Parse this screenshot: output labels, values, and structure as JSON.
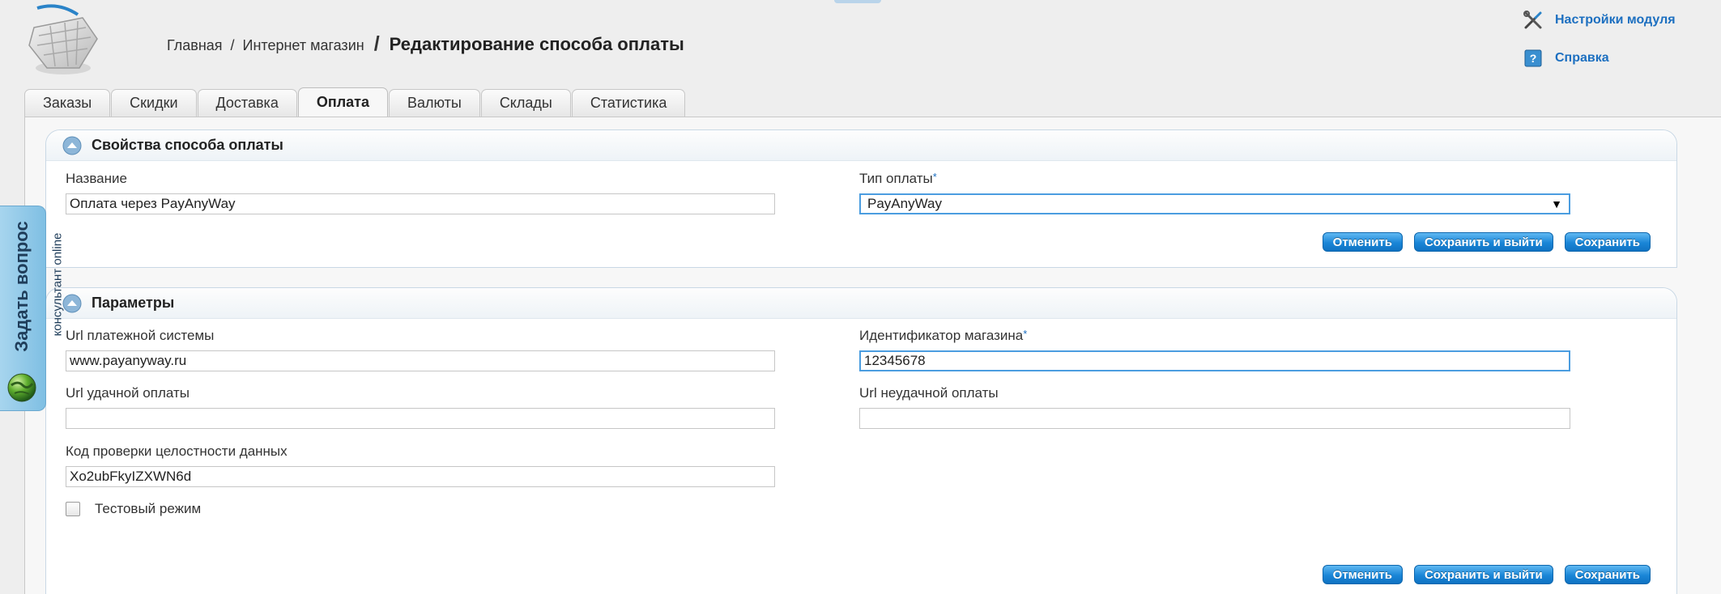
{
  "breadcrumb": {
    "home": "Главная",
    "shop": "Интернет магазин",
    "current": "Редактирование способа оплаты"
  },
  "toplinks": {
    "settings": "Настройки модуля",
    "help": "Справка"
  },
  "tabs": [
    {
      "label": "Заказы"
    },
    {
      "label": "Скидки"
    },
    {
      "label": "Доставка"
    },
    {
      "label": "Оплата"
    },
    {
      "label": "Валюты"
    },
    {
      "label": "Склады"
    },
    {
      "label": "Статистика"
    }
  ],
  "properties": {
    "title": "Свойства способа оплаты",
    "name_label": "Название",
    "name_value": "Оплата через PayAnyWay",
    "type_label": "Тип оплаты",
    "type_value": "PayAnyWay"
  },
  "params": {
    "title": "Параметры",
    "url_label": "Url платежной системы",
    "url_value": "www.payanyway.ru",
    "shop_id_label": "Идентификатор магазина",
    "shop_id_value": "12345678",
    "success_label": "Url удачной оплаты",
    "success_value": "",
    "fail_label": "Url неудачной оплаты",
    "fail_value": "",
    "integrity_label": "Код проверки целостности данных",
    "integrity_value": "Xo2ubFkyIZXWN6d",
    "test_mode_label": "Тестовый режим"
  },
  "buttons": {
    "cancel": "Отменить",
    "save_exit": "Сохранить и выйти",
    "save": "Сохранить"
  },
  "side_widget": {
    "main": "Задать вопрос",
    "sub": "консультант online"
  },
  "required_mark": "*",
  "colors": {
    "accent": "#1c6fc0",
    "button": "#1a86d7",
    "focus_border": "#4b9de0"
  }
}
